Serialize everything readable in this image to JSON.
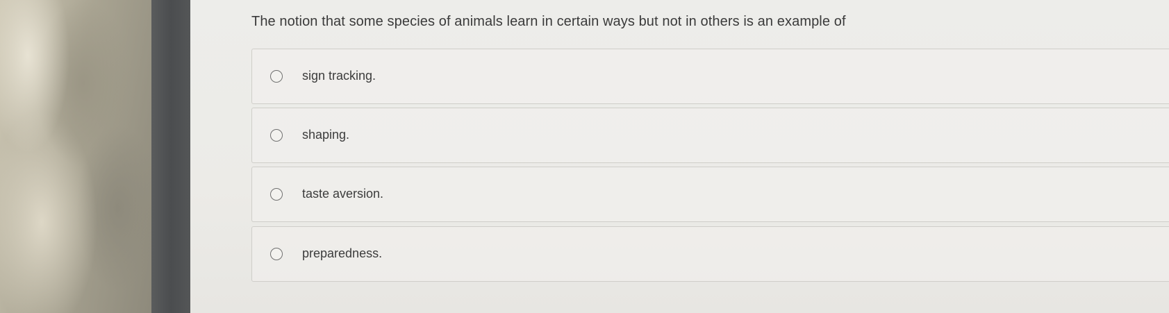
{
  "question": {
    "text": "The notion that some species of animals learn in certain ways but not in others is an example of"
  },
  "options": [
    {
      "label": "sign tracking."
    },
    {
      "label": "shaping."
    },
    {
      "label": "taste aversion."
    },
    {
      "label": "preparedness."
    }
  ]
}
